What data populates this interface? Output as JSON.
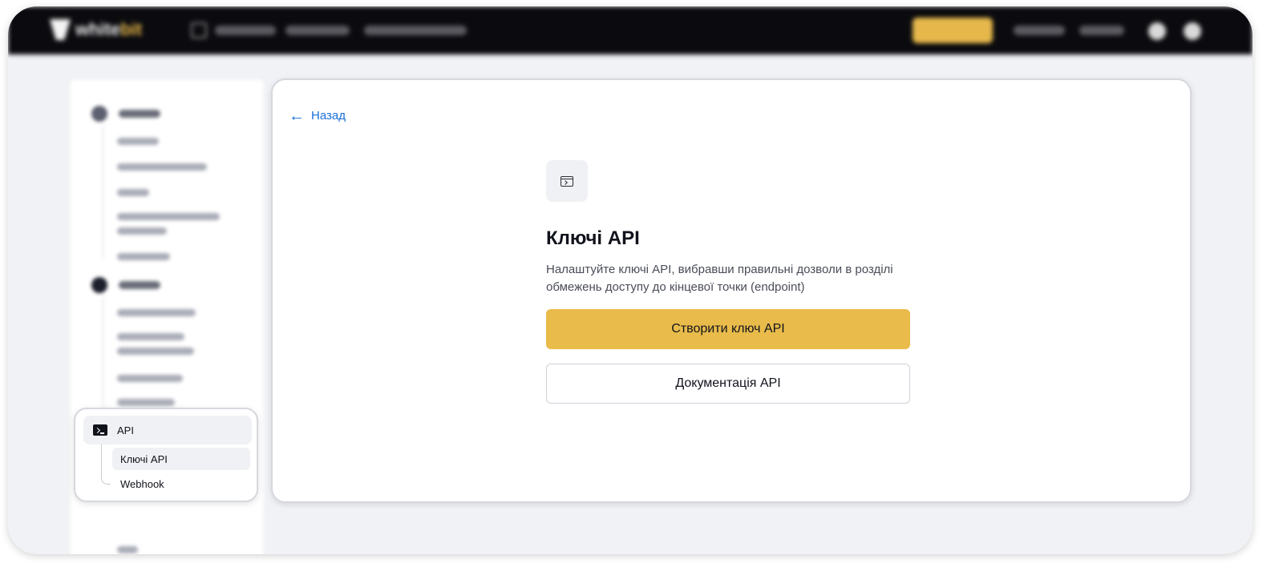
{
  "header": {
    "logo_text_main": "white",
    "logo_text_accent": "bit"
  },
  "sidebar": {
    "api_section": {
      "label": "API",
      "items": [
        {
          "label": "Ключі API",
          "active": true
        },
        {
          "label": "Webhook",
          "active": false
        }
      ]
    }
  },
  "main": {
    "back_label": "Назад",
    "title": "Ключі API",
    "description": "Налаштуйте ключі API, вибравши правильні дозволи в розділі обмежень доступу до кінцевої точки (endpoint)",
    "create_button": "Створити ключ API",
    "docs_button": "Документація API"
  },
  "colors": {
    "accent": "#e9bb4a",
    "link": "#1b6fd6",
    "nav_bg": "#0b0b0f"
  }
}
